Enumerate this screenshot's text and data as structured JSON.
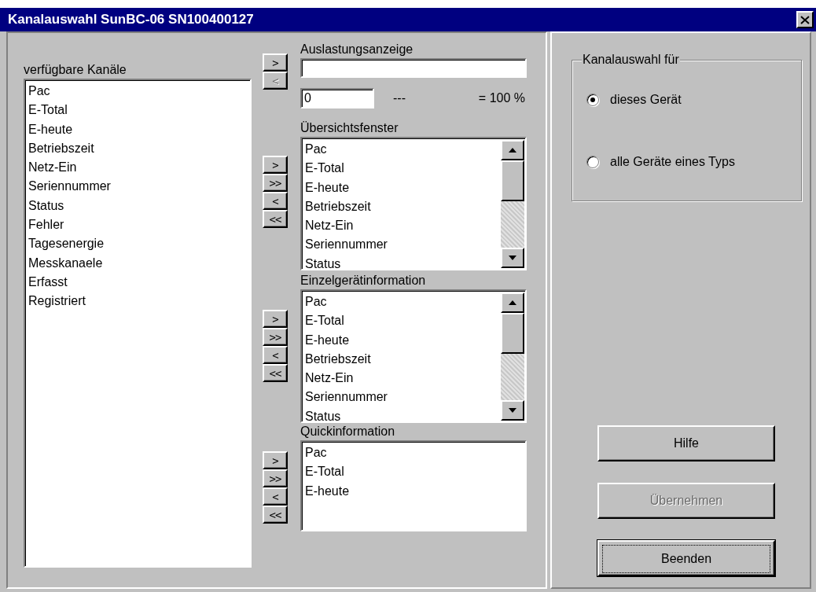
{
  "window": {
    "title": "Kanalauswahl SunBC-06 SN100400127"
  },
  "available": {
    "label": "verfügbare Kanäle",
    "items": [
      "Pac",
      "E-Total",
      "E-heute",
      "Betriebszeit",
      "Netz-Ein",
      "Seriennummer",
      "Status",
      "Fehler",
      "Tagesenergie",
      "Messkanaele",
      "Erfasst",
      "Registriert"
    ]
  },
  "sections": [
    {
      "kind": "gauge",
      "label": "Auslastungsanzeige",
      "buttons": [
        {
          "label": ">",
          "disabled": false
        },
        {
          "label": "<",
          "disabled": true
        }
      ],
      "min_value": "0",
      "separator": "---",
      "max_label": "= 100 %"
    },
    {
      "kind": "list",
      "label": "Übersichtsfenster",
      "scrollbar": true,
      "buttons": [
        {
          "label": ">",
          "disabled": false
        },
        {
          "label": ">>",
          "disabled": false
        },
        {
          "label": "<",
          "disabled": false
        },
        {
          "label": "<<",
          "disabled": false
        }
      ],
      "items": [
        "Pac",
        "E-Total",
        "E-heute",
        "Betriebszeit",
        "Netz-Ein",
        "Seriennummer",
        "Status"
      ]
    },
    {
      "kind": "list",
      "label": "Einzelgerätinformation",
      "scrollbar": true,
      "buttons": [
        {
          "label": ">",
          "disabled": false
        },
        {
          "label": ">>",
          "disabled": false
        },
        {
          "label": "<",
          "disabled": false
        },
        {
          "label": "<<",
          "disabled": false
        }
      ],
      "items": [
        "Pac",
        "E-Total",
        "E-heute",
        "Betriebszeit",
        "Netz-Ein",
        "Seriennummer",
        "Status"
      ]
    },
    {
      "kind": "list",
      "label": "Quickinformation",
      "scrollbar": false,
      "buttons": [
        {
          "label": ">",
          "disabled": false
        },
        {
          "label": ">>",
          "disabled": false
        },
        {
          "label": "<",
          "disabled": false
        },
        {
          "label": "<<",
          "disabled": false
        }
      ],
      "items": [
        "Pac",
        "E-Total",
        "E-heute"
      ]
    }
  ],
  "selection": {
    "label": "Kanalauswahl für",
    "options": [
      {
        "label": "dieses Gerät",
        "selected": true
      },
      {
        "label": "alle Geräte eines Typs",
        "selected": false
      }
    ]
  },
  "buttons": [
    {
      "label": "Hilfe",
      "disabled": false,
      "default": false
    },
    {
      "label": "Übernehmen",
      "disabled": true,
      "default": false
    },
    {
      "label": "Beenden",
      "disabled": false,
      "default": true
    }
  ]
}
